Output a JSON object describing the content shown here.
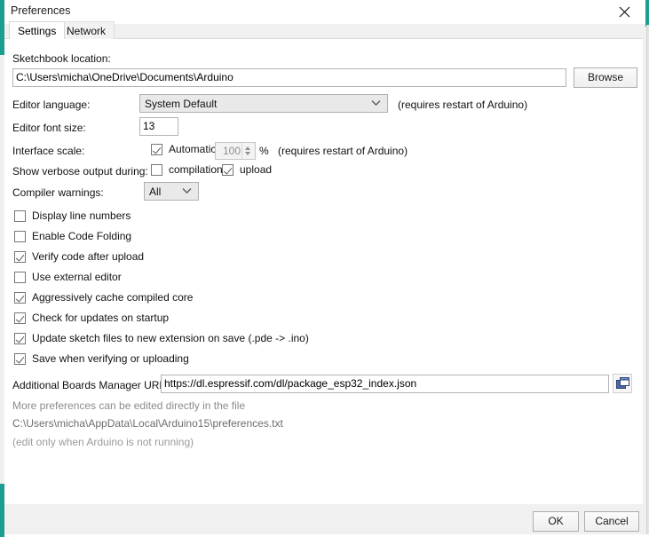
{
  "window": {
    "title": "Preferences",
    "close_icon": "close-icon",
    "accent_color": "#1a9e8f"
  },
  "tabs": [
    {
      "label": "Settings",
      "active": true
    },
    {
      "label": "Network",
      "active": false
    }
  ],
  "settings": {
    "sketchbook": {
      "label": "Sketchbook location:",
      "value": "C:\\Users\\micha\\OneDrive\\Documents\\Arduino",
      "browse_label": "Browse"
    },
    "editor_language": {
      "label": "Editor language:",
      "value": "System Default",
      "note": "(requires restart of Arduino)",
      "chevron_icon": "chevron-down-icon"
    },
    "editor_font_size": {
      "label": "Editor font size:",
      "value": "13"
    },
    "interface_scale": {
      "label": "Interface scale:",
      "automatic_label": "Automatic",
      "automatic_checked": true,
      "scale_value": "100",
      "percent_symbol": "%",
      "note": "(requires restart of Arduino)"
    },
    "verbose_output": {
      "label": "Show verbose output during:",
      "options": [
        {
          "label": "compilation",
          "checked": false
        },
        {
          "label": "upload",
          "checked": true
        }
      ]
    },
    "compiler_warnings": {
      "label": "Compiler warnings:",
      "value": "All",
      "chevron_icon": "chevron-down-icon"
    },
    "checkboxes": [
      {
        "label": "Display line numbers",
        "checked": false
      },
      {
        "label": "Enable Code Folding",
        "checked": false
      },
      {
        "label": "Verify code after upload",
        "checked": true
      },
      {
        "label": "Use external editor",
        "checked": false
      },
      {
        "label": "Aggressively cache compiled core",
        "checked": true
      },
      {
        "label": "Check for updates on startup",
        "checked": true
      },
      {
        "label": "Update sketch files to new extension on save (.pde -> .ino)",
        "checked": true
      },
      {
        "label": "Save when verifying or uploading",
        "checked": true
      }
    ],
    "boards_urls": {
      "label": "Additional Boards Manager URLs:",
      "value": "https://dl.espressif.com/dl/package_esp32_index.json",
      "expand_icon": "open-window-icon"
    },
    "footnotes": [
      "More preferences can be edited directly in the file",
      "C:\\Users\\micha\\AppData\\Local\\Arduino15\\preferences.txt",
      "(edit only when Arduino is not running)"
    ]
  },
  "footer": {
    "ok_label": "OK",
    "cancel_label": "Cancel"
  }
}
